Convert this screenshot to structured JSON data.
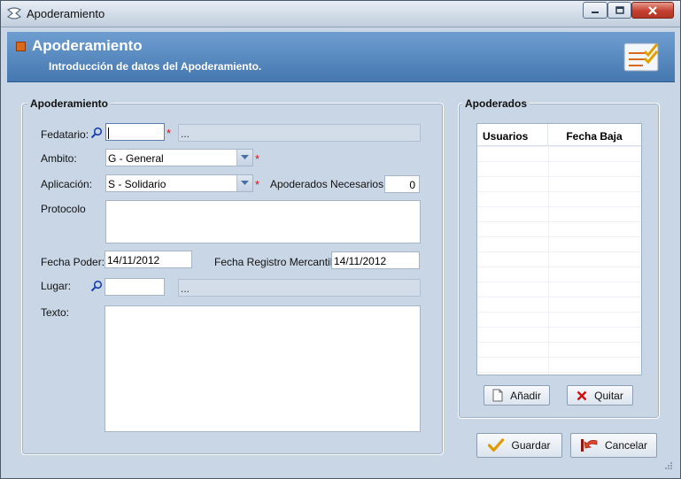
{
  "window": {
    "title": "Apoderamiento"
  },
  "header": {
    "title": "Apoderamiento",
    "subtitle": "Introducción de datos del Apoderamiento."
  },
  "form": {
    "group_label": "Apoderamiento",
    "fedatario": {
      "label": "Fedatario:",
      "value": "",
      "description": "..."
    },
    "ambito": {
      "label": "Ambito:",
      "value": "G - General"
    },
    "aplicacion": {
      "label": "Aplicación:",
      "value": "S - Solidario"
    },
    "apoderados_necesarios": {
      "label": "Apoderados Necesarios:",
      "value": "0"
    },
    "protocolo": {
      "label": "Protocolo",
      "value": ""
    },
    "fecha_poder": {
      "label": "Fecha Poder:",
      "value": "14/11/2012"
    },
    "fecha_registro": {
      "label": "Fecha Registro Mercantil:",
      "value": "14/11/2012"
    },
    "lugar": {
      "label": "Lugar:",
      "value": "",
      "description": "..."
    },
    "texto": {
      "label": "Texto:",
      "value": ""
    },
    "required_marker": "*"
  },
  "apoderados": {
    "group_label": "Apoderados",
    "columns": [
      "Usuarios",
      "Fecha Baja"
    ],
    "rows": [],
    "add_label": "Añadir",
    "remove_label": "Quitar"
  },
  "actions": {
    "save_label": "Guardar",
    "cancel_label": "Cancelar"
  },
  "colors": {
    "header": "#4577b0",
    "body": "#c9d6e6",
    "required": "#d41111",
    "accent": "#d96a1b"
  }
}
